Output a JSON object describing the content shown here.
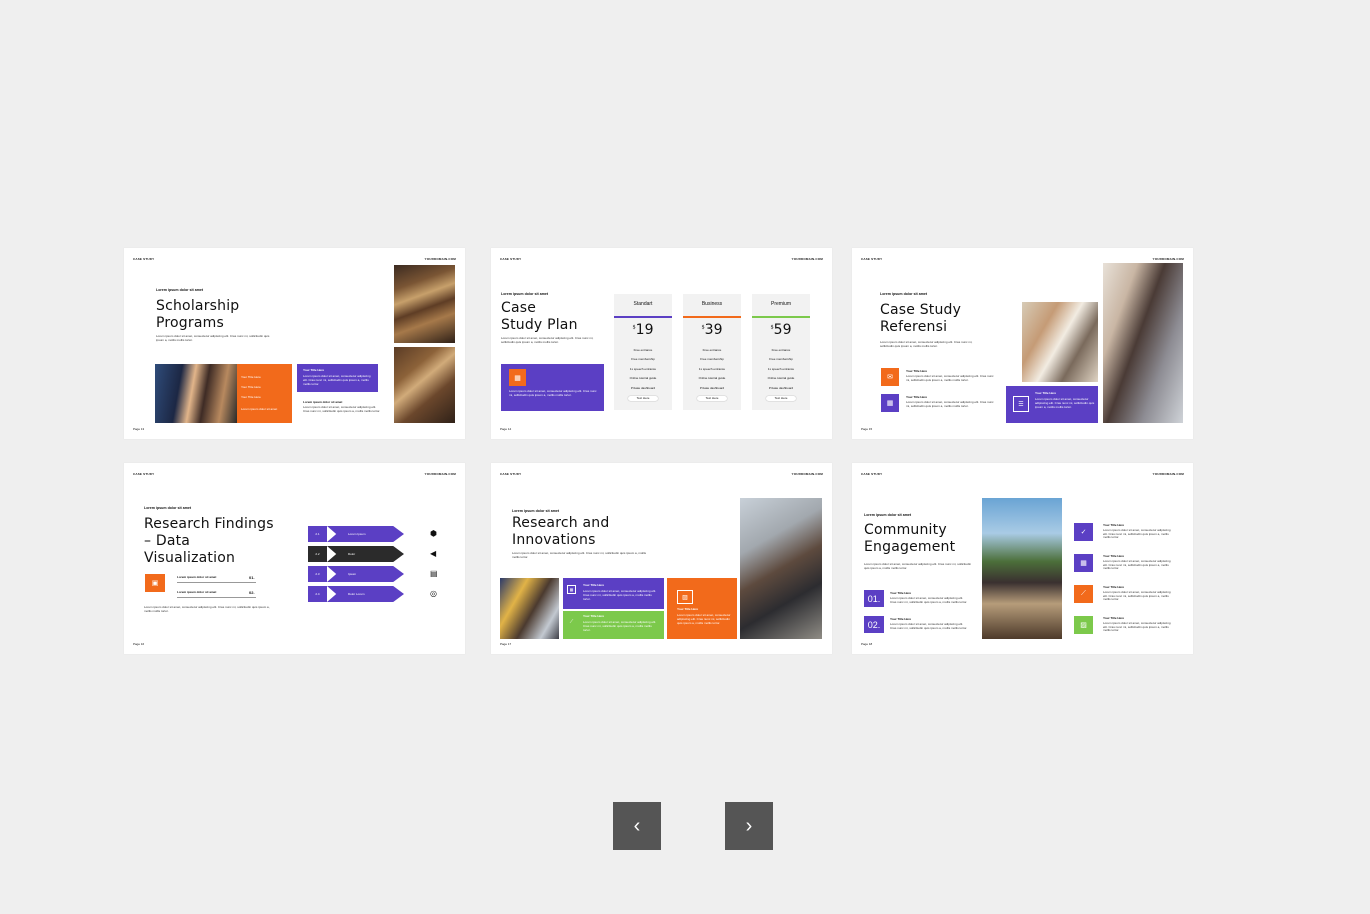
{
  "common": {
    "header_left": "CASE STUDY",
    "header_right": "YOURDOMAIN.COM",
    "kicker": "Lorem ipsum dolor sit amet",
    "body": "Lorem ipsum dolor sit amet, consectetur adipiscing elit. Cras nunc mi, sollicitudin quis ipsum a, mollis mollis tortor.",
    "box_title": "Your Title Here",
    "text_here": "Text Here"
  },
  "slides": [
    {
      "title1": "Scholarship",
      "title2": "Programs",
      "page": "Page 13",
      "items": [
        "Your Title Here",
        "Your Title Here",
        "Your Title Here",
        "Your Title Here"
      ]
    },
    {
      "title1": "Case",
      "title2": "Study Plan",
      "page": "Page 14",
      "plans": [
        {
          "name": "Standart",
          "price": "19",
          "currency": "$"
        },
        {
          "name": "Business",
          "price": "39",
          "currency": "$"
        },
        {
          "name": "Premium",
          "price": "59",
          "currency": "$"
        }
      ],
      "features": [
        "Free entrance",
        "Free membership",
        "1x speech entrance",
        "Online tutorial guide",
        "Private dashboard"
      ]
    },
    {
      "title1": "Case Study",
      "title2": "Referensi",
      "page": "Page 15"
    },
    {
      "title1": "Research Findings",
      "title2": "– Data",
      "title3": "Visualization",
      "page": "Page 16",
      "steps": [
        {
          "num": "2.1",
          "label": "Lorem Ipsum"
        },
        {
          "num": "2.2",
          "label": "Dolor"
        },
        {
          "num": "2.3",
          "label": "Ipsum"
        },
        {
          "num": "2.4",
          "label": "Dolor Lorem"
        }
      ],
      "stats": [
        {
          "label": "Lorem ipsum dolor sit amet",
          "value": "01."
        },
        {
          "label": "Lorem ipsum dolor sit amet",
          "value": "02."
        }
      ]
    },
    {
      "title1": "Research and",
      "title2": "Innovations",
      "page": "Page 17"
    },
    {
      "title1": "Community",
      "title2": "Engagement",
      "page": "Page 18",
      "numbered": [
        {
          "num": "01.",
          "title": "Your Title Here"
        },
        {
          "num": "02.",
          "title": "Your Title Here"
        }
      ]
    }
  ],
  "nav": {
    "prev_icon": "‹",
    "next_icon": "›"
  },
  "colors": {
    "purple": "#5b3fc4",
    "orange": "#f26a1b",
    "green": "#7cc94b",
    "dark": "#2b2b2b"
  }
}
